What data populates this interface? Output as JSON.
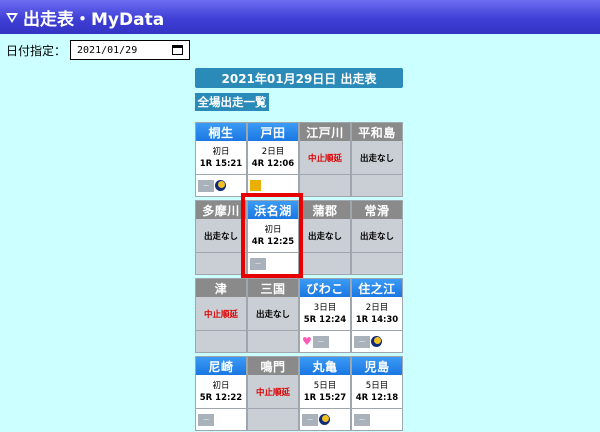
{
  "app": {
    "title": "出走表・MyData"
  },
  "date_picker": {
    "label": "日付指定：",
    "value": "2021/01/29"
  },
  "schedule": {
    "header": "2021年01月29日日 出走表",
    "all_button": "全場出走一覧"
  },
  "colors": {
    "background": "#ccffff",
    "title_bar": "#3f3fd6",
    "header_blue": "#2a8ab8",
    "active_tab": "#1b77e2",
    "inactive_tab": "#8a8a8a",
    "red_text": "#e00000",
    "highlight": "#e60000"
  },
  "venues": [
    {
      "name": "桐生",
      "active": true,
      "day": "初日",
      "race": "1R 15:21",
      "status": "",
      "icons": [
        "badge-icon",
        "moon-icon"
      ]
    },
    {
      "name": "戸田",
      "active": true,
      "day": "2日目",
      "race": "4R 12:06",
      "status": "",
      "icons": [
        "g1-icon"
      ]
    },
    {
      "name": "江戸川",
      "active": false,
      "day": "",
      "race": "",
      "status": "中止順延",
      "status_red": true,
      "icons": []
    },
    {
      "name": "平和島",
      "active": false,
      "day": "",
      "race": "",
      "status": "出走なし",
      "status_red": false,
      "icons": []
    },
    {
      "name": "多摩川",
      "active": false,
      "day": "",
      "race": "",
      "status": "出走なし",
      "status_red": false,
      "icons": []
    },
    {
      "name": "浜名湖",
      "active": true,
      "day": "初日",
      "race": "4R 12:25",
      "status": "",
      "icons": [
        "badge-icon"
      ]
    },
    {
      "name": "蒲郡",
      "active": false,
      "day": "",
      "race": "",
      "status": "出走なし",
      "status_red": false,
      "icons": []
    },
    {
      "name": "常滑",
      "active": false,
      "day": "",
      "race": "",
      "status": "出走なし",
      "status_red": false,
      "icons": []
    },
    {
      "name": "津",
      "active": false,
      "day": "",
      "race": "",
      "status": "中止順延",
      "status_red": true,
      "icons": []
    },
    {
      "name": "三国",
      "active": false,
      "day": "",
      "race": "",
      "status": "出走なし",
      "status_red": false,
      "icons": []
    },
    {
      "name": "びわこ",
      "active": true,
      "day": "3日目",
      "race": "5R 12:24",
      "status": "",
      "icons": [
        "heart-icon",
        "badge-icon"
      ]
    },
    {
      "name": "住之江",
      "active": true,
      "day": "2日目",
      "race": "1R 14:30",
      "status": "",
      "icons": [
        "badge-icon",
        "moon-icon"
      ]
    },
    {
      "name": "尼崎",
      "active": true,
      "day": "初日",
      "race": "5R 12:22",
      "status": "",
      "icons": [
        "badge-icon"
      ]
    },
    {
      "name": "鳴門",
      "active": false,
      "day": "",
      "race": "",
      "status": "中止順延",
      "status_red": true,
      "icons": []
    },
    {
      "name": "丸亀",
      "active": true,
      "day": "5日目",
      "race": "1R 15:27",
      "status": "",
      "icons": [
        "badge-icon",
        "moon-icon"
      ]
    },
    {
      "name": "児島",
      "active": true,
      "day": "5日目",
      "race": "4R 12:18",
      "status": "",
      "icons": [
        "badge-icon"
      ]
    }
  ]
}
